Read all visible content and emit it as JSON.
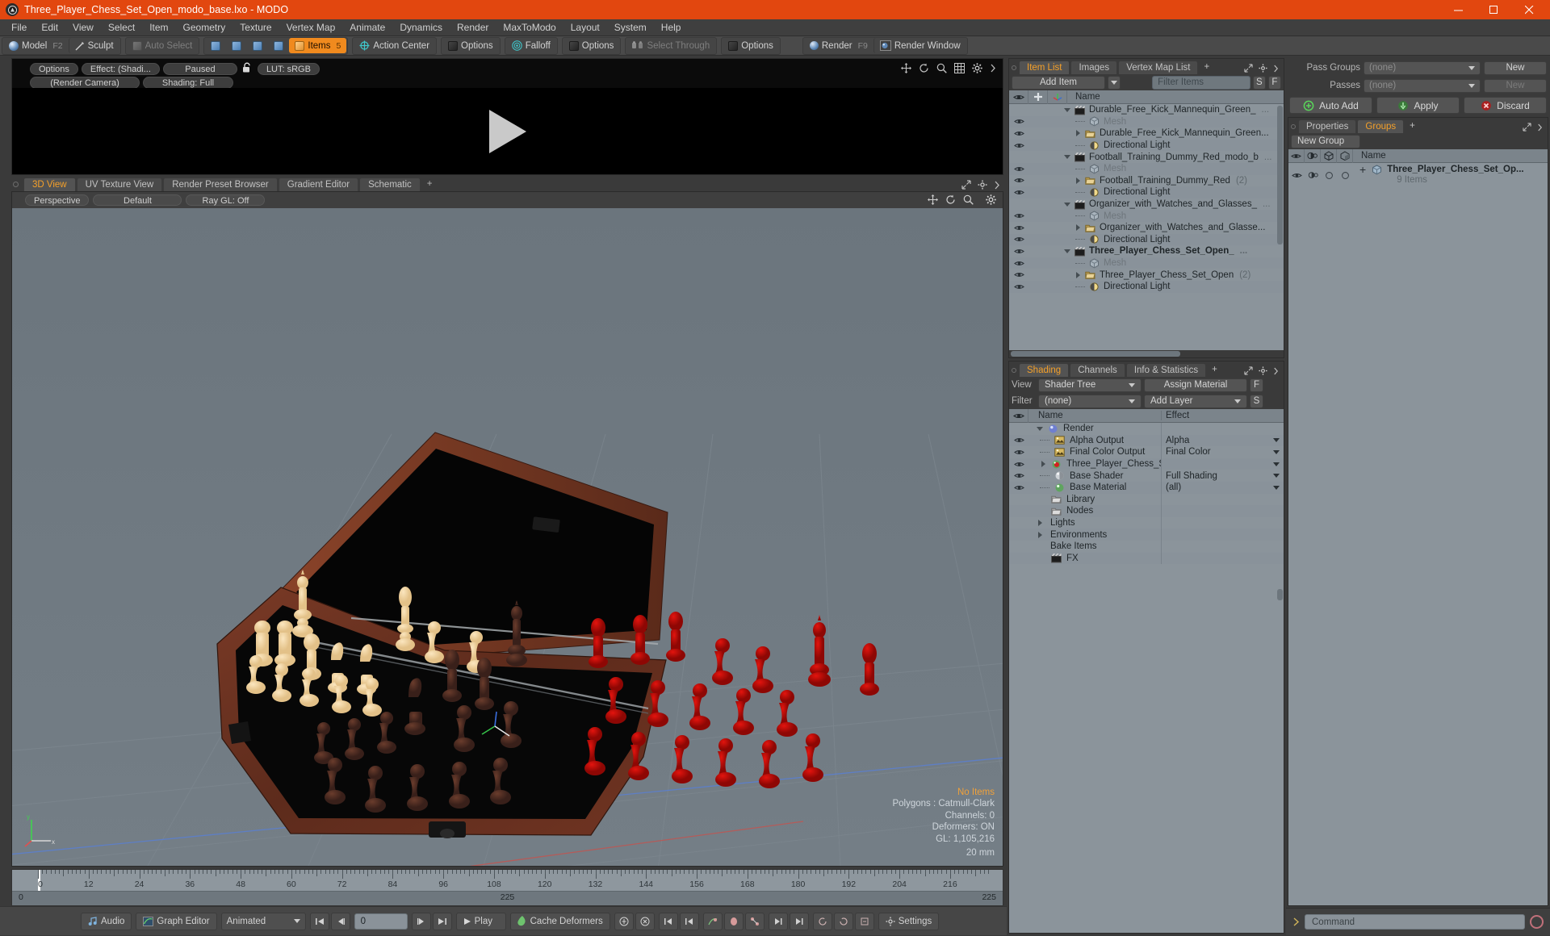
{
  "window": {
    "title": "Three_Player_Chess_Set_Open_modo_base.lxo - MODO",
    "app_icon": "modo-logo-icon",
    "minimize": "minimize-icon",
    "maximize": "maximize-icon",
    "close": "close-icon",
    "titlebar_color": "#e2470f"
  },
  "menu": {
    "items": [
      "File",
      "Edit",
      "View",
      "Select",
      "Item",
      "Geometry",
      "Texture",
      "Vertex Map",
      "Animate",
      "Dynamics",
      "Render",
      "MaxToModo",
      "Layout",
      "System",
      "Help"
    ]
  },
  "toolbar": {
    "mode": {
      "model": "Model",
      "model_key": "F2",
      "sculpt": "Sculpt"
    },
    "auto_select": "Auto Select",
    "items": "Items",
    "items_key": "5",
    "action_center": "Action Center",
    "options1": "Options",
    "falloff": "Falloff",
    "options2": "Options",
    "select_through": "Select Through",
    "options3": "Options",
    "render": "Render",
    "render_key": "F9",
    "render_window": "Render Window",
    "accent": "#f08a1e"
  },
  "preview": {
    "options": "Options",
    "effect": "Effect: (Shadi...",
    "paused": "Paused",
    "lock_icon": "unlock-icon",
    "lut": "LUT: sRGB",
    "camera": "(Render Camera)",
    "shading": "Shading: Full",
    "icons": [
      "move-icon",
      "rotate-icon",
      "zoom-icon",
      "grid-icon",
      "gear-icon",
      "chevron-right-icon"
    ],
    "play_icon": "play-icon"
  },
  "viewport": {
    "tabs": [
      {
        "label": "3D View",
        "active": true
      },
      {
        "label": "UV Texture View",
        "active": false
      },
      {
        "label": "Render Preset Browser",
        "active": false
      },
      {
        "label": "Gradient Editor",
        "active": false
      },
      {
        "label": "Schematic",
        "active": false
      },
      {
        "label": "+",
        "active": false
      }
    ],
    "header": [
      "Perspective",
      "Default",
      "Ray GL: Off"
    ],
    "icons": [
      "move-icon",
      "rotate-icon",
      "zoom-icon",
      "gear-icon"
    ],
    "stats": {
      "selection": "No Items",
      "polygons": "Polygons : Catmull-Clark",
      "channels": "Channels: 0",
      "deformers": "Deformers: ON",
      "gl": "GL: 1,105,216",
      "scale": "20 mm"
    },
    "axis_labels": {
      "x": "x",
      "y": "y",
      "z": "z"
    }
  },
  "timeline": {
    "ticks": [
      "0",
      "12",
      "24",
      "36",
      "48",
      "60",
      "72",
      "84",
      "96",
      "108",
      "120",
      "132",
      "144",
      "156",
      "168",
      "180",
      "192",
      "204",
      "216"
    ],
    "range_start": "0",
    "range_mid": "225",
    "range_end": "225"
  },
  "bottom_bar": {
    "audio": "Audio",
    "graph_editor": "Graph Editor",
    "mode": "Animated",
    "frame": "0",
    "play": "Play",
    "cache_deformers": "Cache Deformers",
    "settings": "Settings",
    "transport": [
      "skip-start-icon",
      "step-back-icon",
      "step-forward-icon",
      "skip-end-icon"
    ],
    "key_tools": [
      "key-icon",
      "key-delete-icon",
      "prev-key-icon",
      "next-key-icon",
      "curve-icon",
      "ellipse-icon",
      "skeleton-icon",
      "range-in-icon",
      "range-out-icon",
      "cycle-icon",
      "reverse-icon",
      "bake-icon"
    ]
  },
  "item_list": {
    "tabs": [
      {
        "label": "Item List",
        "active": true
      },
      {
        "label": "Images",
        "active": false
      },
      {
        "label": "Vertex Map List",
        "active": false
      },
      {
        "label": "+",
        "active": false
      }
    ],
    "add_item": "Add Item",
    "filter_placeholder": "Filter Items",
    "btn_s": "S",
    "btn_f": "F",
    "columns": [
      "eye-icon",
      "add-icon",
      "axis-icon",
      "Name"
    ],
    "rows": [
      {
        "indent": 0,
        "toggle": "down",
        "icon": "scene-icon",
        "label": "Durable_Free_Kick_Mannequin_Green_",
        "suffix": "...",
        "eye": false,
        "bold": false,
        "muted": false
      },
      {
        "indent": 1,
        "toggle": "none",
        "icon": "mesh-icon",
        "label": "Mesh",
        "suffix": "",
        "eye": true,
        "bold": false,
        "muted": true
      },
      {
        "indent": 1,
        "toggle": "right",
        "icon": "group-icon",
        "label": "Durable_Free_Kick_Mannequin_Green...",
        "suffix": "",
        "eye": true,
        "bold": false,
        "muted": false
      },
      {
        "indent": 1,
        "toggle": "none",
        "icon": "light-icon",
        "label": "Directional Light",
        "suffix": "",
        "eye": true,
        "bold": false,
        "muted": false
      },
      {
        "indent": 0,
        "toggle": "down",
        "icon": "scene-icon",
        "label": "Football_Training_Dummy_Red_modo_b",
        "suffix": "...",
        "eye": false,
        "bold": false,
        "muted": false
      },
      {
        "indent": 1,
        "toggle": "none",
        "icon": "mesh-icon",
        "label": "Mesh",
        "suffix": "",
        "eye": true,
        "bold": false,
        "muted": true
      },
      {
        "indent": 1,
        "toggle": "right",
        "icon": "group-icon",
        "label": "Football_Training_Dummy_Red",
        "suffix": "(2)",
        "eye": true,
        "bold": false,
        "muted": false
      },
      {
        "indent": 1,
        "toggle": "none",
        "icon": "light-icon",
        "label": "Directional Light",
        "suffix": "",
        "eye": true,
        "bold": false,
        "muted": false
      },
      {
        "indent": 0,
        "toggle": "down",
        "icon": "scene-icon",
        "label": "Organizer_with_Watches_and_Glasses_",
        "suffix": "...",
        "eye": false,
        "bold": false,
        "muted": false
      },
      {
        "indent": 1,
        "toggle": "none",
        "icon": "mesh-icon",
        "label": "Mesh",
        "suffix": "",
        "eye": true,
        "bold": false,
        "muted": true
      },
      {
        "indent": 1,
        "toggle": "right",
        "icon": "group-icon",
        "label": "Organizer_with_Watches_and_Glasse...",
        "suffix": "",
        "eye": true,
        "bold": false,
        "muted": false
      },
      {
        "indent": 1,
        "toggle": "none",
        "icon": "light-icon",
        "label": "Directional Light",
        "suffix": "",
        "eye": true,
        "bold": false,
        "muted": false
      },
      {
        "indent": 0,
        "toggle": "down",
        "icon": "scene-icon",
        "label": "Three_Player_Chess_Set_Open_",
        "suffix": "...",
        "eye": true,
        "bold": true,
        "muted": false
      },
      {
        "indent": 1,
        "toggle": "none",
        "icon": "mesh-icon",
        "label": "Mesh",
        "suffix": "",
        "eye": true,
        "bold": false,
        "muted": true
      },
      {
        "indent": 1,
        "toggle": "right",
        "icon": "group-icon",
        "label": "Three_Player_Chess_Set_Open",
        "suffix": "(2)",
        "eye": true,
        "bold": false,
        "muted": false
      },
      {
        "indent": 1,
        "toggle": "none",
        "icon": "light-icon",
        "label": "Directional Light",
        "suffix": "",
        "eye": true,
        "bold": false,
        "muted": false
      }
    ]
  },
  "shading": {
    "tabs": [
      {
        "label": "Shading",
        "active": true
      },
      {
        "label": "Channels",
        "active": false
      },
      {
        "label": "Info & Statistics",
        "active": false
      },
      {
        "label": "+",
        "active": false
      }
    ],
    "view_label": "View",
    "view_value": "Shader Tree",
    "assign_material": "Assign Material",
    "btn_f": "F",
    "filter_label": "Filter",
    "filter_value": "(none)",
    "add_layer": "Add Layer",
    "btn_s": "S",
    "columns": [
      "eye-icon",
      "Name",
      "Effect"
    ],
    "rows": [
      {
        "indent": 0,
        "toggle": "down",
        "icon": "render-icon",
        "label": "Render",
        "effect": "",
        "eye": false,
        "dropdown": false
      },
      {
        "indent": 1,
        "toggle": "dash",
        "icon": "output-icon",
        "label": "Alpha Output",
        "effect": "Alpha",
        "eye": true,
        "dropdown": true
      },
      {
        "indent": 1,
        "toggle": "dash",
        "icon": "output-icon",
        "label": "Final Color Output",
        "effect": "Final Color",
        "eye": true,
        "dropdown": true
      },
      {
        "indent": 1,
        "toggle": "right",
        "icon": "material-red-icon",
        "label": "Three_Player_Chess_Set_...",
        "effect": "",
        "eye": true,
        "dropdown": true
      },
      {
        "indent": 1,
        "toggle": "dash",
        "icon": "shader-icon",
        "label": "Base Shader",
        "effect": "Full Shading",
        "eye": true,
        "dropdown": true
      },
      {
        "indent": 1,
        "toggle": "dash",
        "icon": "material-green-icon",
        "label": "Base Material",
        "effect": "(all)",
        "eye": true,
        "dropdown": true
      },
      {
        "indent": 1,
        "toggle": "none",
        "icon": "folder-icon",
        "label": "Library",
        "effect": "",
        "eye": false,
        "dropdown": false
      },
      {
        "indent": 1,
        "toggle": "none",
        "icon": "folder-icon",
        "label": "Nodes",
        "effect": "",
        "eye": false,
        "dropdown": false
      },
      {
        "indent": 0,
        "toggle": "right",
        "icon": "none",
        "label": "Lights",
        "effect": "",
        "eye": false,
        "dropdown": false
      },
      {
        "indent": 0,
        "toggle": "right",
        "icon": "none",
        "label": "Environments",
        "effect": "",
        "eye": false,
        "dropdown": false
      },
      {
        "indent": 0,
        "toggle": "none",
        "icon": "none",
        "label": "Bake Items",
        "effect": "",
        "eye": false,
        "dropdown": false
      },
      {
        "indent": 1,
        "toggle": "none",
        "icon": "fx-icon",
        "label": "FX",
        "effect": "",
        "eye": false,
        "dropdown": false
      }
    ]
  },
  "passes": {
    "pass_groups_label": "Pass Groups",
    "pass_groups_value": "(none)",
    "pass_groups_new": "New",
    "passes_label": "Passes",
    "passes_value": "(none)",
    "passes_new": "New",
    "auto_add": "Auto Add",
    "apply": "Apply",
    "discard": "Discard"
  },
  "groups": {
    "tabs": [
      {
        "label": "Properties",
        "active": false
      },
      {
        "label": "Groups",
        "active": true
      },
      {
        "label": "+",
        "active": false
      }
    ],
    "new_group": "New Group",
    "columns": [
      "eye-icon",
      "render-visibility-icon",
      "wireframe-icon",
      "shaded-icon",
      "Name"
    ],
    "rows": [
      {
        "label": "Three_Player_Chess_Set_Op...",
        "sub": "9 Items",
        "icon": "group-cube-icon"
      }
    ]
  },
  "command_bar": {
    "prompt_icon": "chevron-right-icon",
    "placeholder": "Command",
    "record_icon": "record-icon"
  }
}
